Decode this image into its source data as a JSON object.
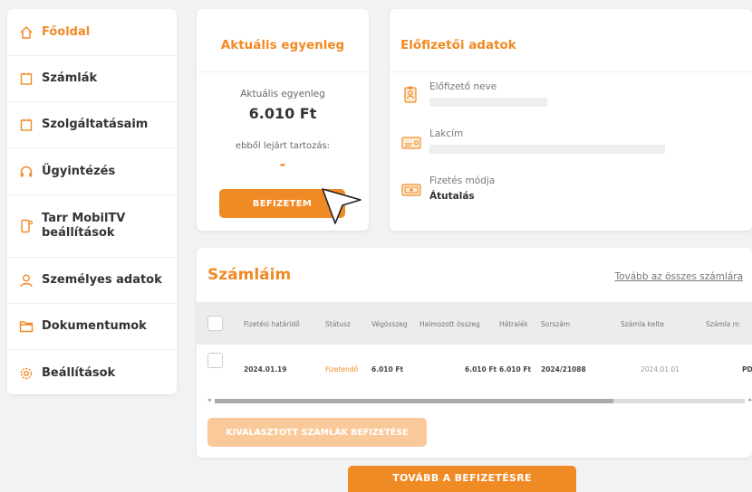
{
  "sidebar": {
    "items": [
      {
        "label": "Főoldal",
        "icon": "home-icon"
      },
      {
        "label": "Számlák",
        "icon": "invoice-icon"
      },
      {
        "label": "Szolgáltatásaim",
        "icon": "services-icon"
      },
      {
        "label": "Ügyintézés",
        "icon": "headset-icon"
      },
      {
        "label": "Tarr MobilTV beállítások",
        "icon": "mobile-tv-icon"
      },
      {
        "label": "Személyes adatok",
        "icon": "user-icon"
      },
      {
        "label": "Dokumentumok",
        "icon": "folder-icon"
      },
      {
        "label": "Beállítások",
        "icon": "gear-icon"
      }
    ]
  },
  "balance": {
    "title": "Aktuális egyenleg",
    "label": "Aktuális egyenleg",
    "value": "6.010 Ft",
    "overdue_label": "ebből lejárt tartozás:",
    "overdue_value": "-",
    "pay_button": "BEFIZETEM"
  },
  "subscriber": {
    "title": "Előfizetői adatok",
    "name_label": "Előfizető neve",
    "address_label": "Lakcím",
    "payment_label": "Fizetés módja",
    "payment_value": "Átutalás"
  },
  "invoices": {
    "title": "Számláim",
    "all_link": "Tovább az összes számlára",
    "columns": [
      "Fizetési határidő",
      "Státusz",
      "Végösszeg",
      "Halmozott összeg",
      "Hátralék",
      "Sorszám",
      "Számla kelte",
      "Számla m"
    ],
    "rows": [
      {
        "due": "2024.01.19",
        "status": "Fizetendő",
        "total": "6.010 Ft",
        "cumulative": "6.010 Ft",
        "arrears": "6.010 Ft",
        "number": "2024/21088",
        "date": "2024.01.01",
        "extra": "PD"
      }
    ],
    "pay_selected_button": "KIVÁLASZTOTT SZÁMLÁK BEFIZETÉSE"
  },
  "continue_button": "TOVÁBB A BEFIZETÉSRE",
  "colors": {
    "accent": "#f08a24",
    "accent_light": "#f9c99a"
  }
}
